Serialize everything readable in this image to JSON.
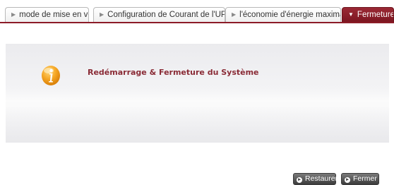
{
  "tabs": [
    {
      "label": "mode de mise en veille",
      "active": false
    },
    {
      "label": "Configuration de Courant de l'UPS",
      "active": false
    },
    {
      "label": "l'économie d'énergie maximale",
      "active": false
    },
    {
      "label": "Fermeture",
      "active": true
    }
  ],
  "panel": {
    "title": "Redémarrage & Fermeture du Système",
    "icon": "info-icon"
  },
  "buttons": {
    "restore_label": "Restaurer",
    "close_label": "Fermer"
  },
  "colors": {
    "accent": "#8c1c28",
    "title_text": "#8a2b36",
    "icon_orange": "#f5a623"
  }
}
